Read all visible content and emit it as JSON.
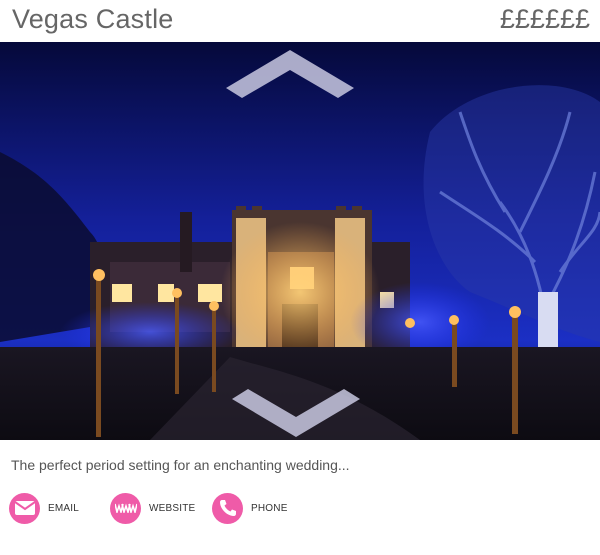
{
  "header": {
    "title": "Vegas Castle",
    "price": "££££££"
  },
  "photo": {
    "subject": "castle-at-night-image"
  },
  "description": "The perfect period setting for an enchanting wedding...",
  "contacts": {
    "email": {
      "label": "EMAIL",
      "icon": "envelope-icon"
    },
    "website": {
      "label": "WEBSITE",
      "icon": "www-icon"
    },
    "phone": {
      "label": "PHONE",
      "icon": "phone-icon"
    }
  },
  "colors": {
    "accent": "#ef5ba8",
    "title": "#666666",
    "sky": "#0b1052"
  }
}
